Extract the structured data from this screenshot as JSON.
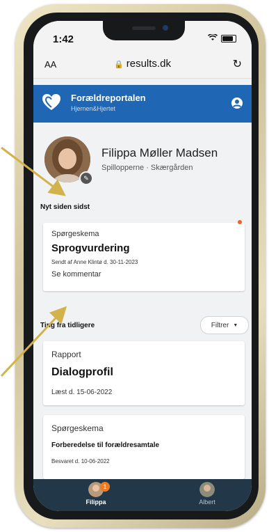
{
  "status_bar": {
    "time": "1:42"
  },
  "browser": {
    "text_size_label": "AA",
    "url": "results.dk"
  },
  "app": {
    "title": "Forældreportalen",
    "subtitle": "Hjernen&Hjertet"
  },
  "profile": {
    "name": "Filippa Møller Madsen",
    "groups": "Spillopperne · Skærgården"
  },
  "new_section": {
    "title": "Nyt siden sidst",
    "card": {
      "type": "Spørgeskema",
      "title": "Sprogvurdering",
      "sent": "Sendt af Anne Klintø d. 30-11-2023",
      "comment_link": "Se kommentar"
    }
  },
  "earlier_section": {
    "title": "Ting fra tidligere",
    "filter_label": "Filtrer",
    "cards": [
      {
        "type": "Rapport",
        "title": "Dialogprofil",
        "meta": "Læst d. 15-06-2022"
      },
      {
        "type": "Spørgeskema",
        "title": "Forberedelse til forældresamtale",
        "meta": "Besvaret d. 10-06-2022"
      }
    ]
  },
  "bottom_nav": {
    "items": [
      {
        "label": "Filippa",
        "badge": "1"
      },
      {
        "label": "Albert"
      }
    ]
  },
  "colors": {
    "header": "#1f66b5",
    "nav": "#223848",
    "badge": "#f07b24",
    "arrow": "#d2b24a"
  }
}
